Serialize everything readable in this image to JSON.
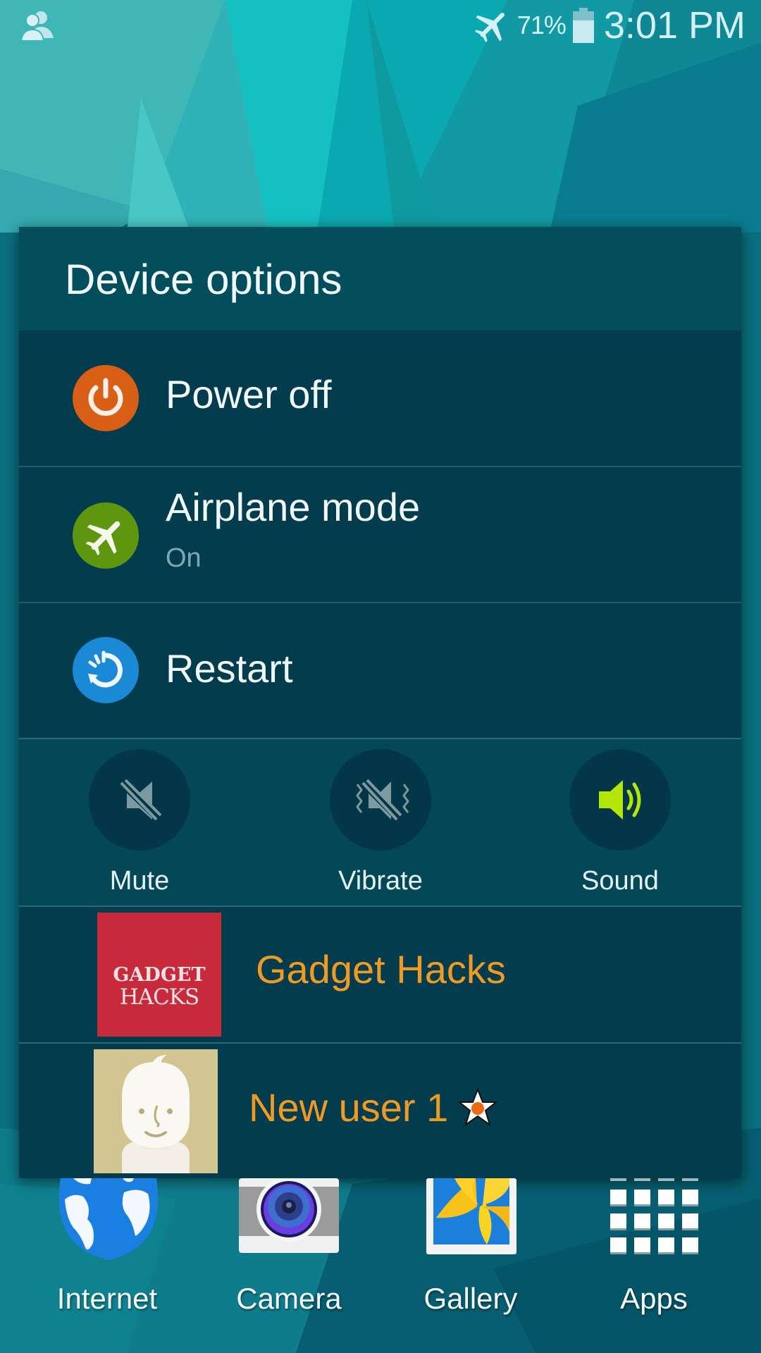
{
  "status_bar": {
    "left_icon": "multi-user-icon",
    "airplane_icon": "airplane-icon",
    "battery_percent": "71%",
    "battery_level": 0.71,
    "time": "3:01 PM"
  },
  "dialog": {
    "title": "Device options",
    "options": [
      {
        "label": "Power off",
        "icon": "power-icon",
        "color": "#d95f17"
      },
      {
        "label": "Airplane mode",
        "sublabel": "On",
        "icon": "airplane-icon",
        "color": "#5e9610"
      },
      {
        "label": "Restart",
        "icon": "restart-icon",
        "color": "#1a8ad6"
      }
    ],
    "sound_modes": [
      {
        "label": "Mute",
        "icon": "mute-icon",
        "active": false
      },
      {
        "label": "Vibrate",
        "icon": "vibrate-icon",
        "active": false
      },
      {
        "label": "Sound",
        "icon": "sound-icon",
        "active": true
      }
    ],
    "users": [
      {
        "label": "Gadget Hacks",
        "logo_line1": "GADGET",
        "logo_line2": "HACKS"
      },
      {
        "label": "New user 1",
        "badge": "star-badge-icon"
      }
    ],
    "colors": {
      "header_bg": "#034e5d",
      "list_bg": "#033c4c",
      "user_label": "#f09a26",
      "sound_active": "#b4e60a"
    }
  },
  "dock": [
    {
      "label": "Internet",
      "icon": "globe-icon"
    },
    {
      "label": "Camera",
      "icon": "camera-icon"
    },
    {
      "label": "Gallery",
      "icon": "gallery-icon"
    },
    {
      "label": "Apps",
      "icon": "apps-grid-icon"
    }
  ]
}
